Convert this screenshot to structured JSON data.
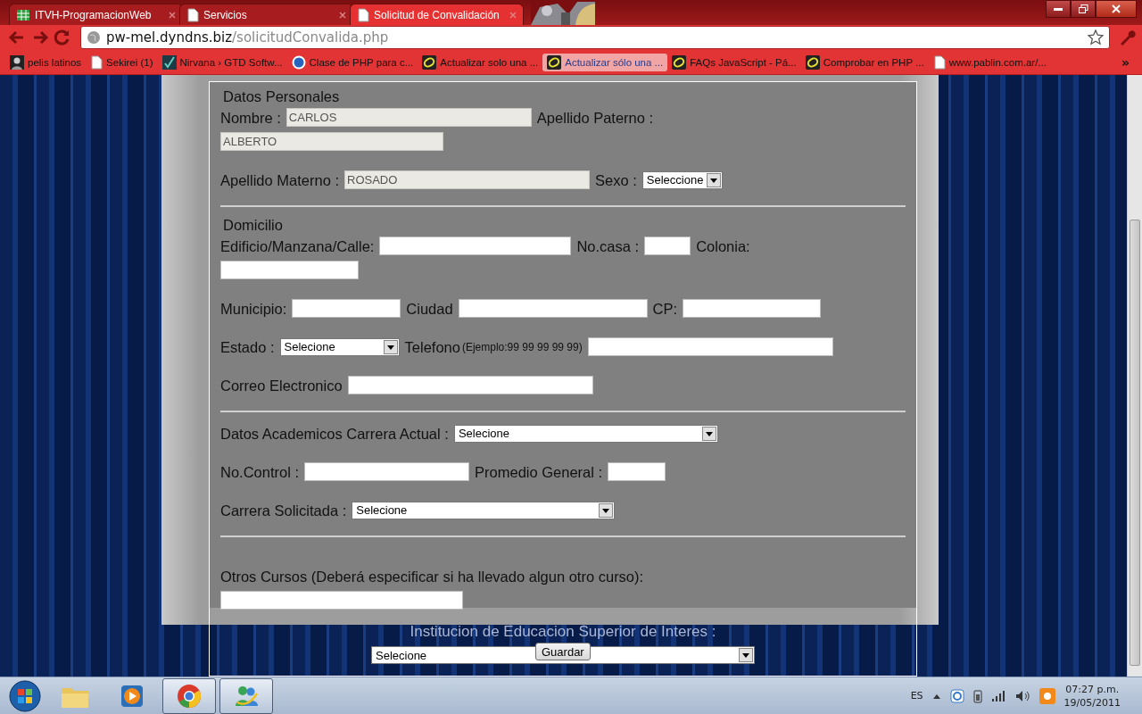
{
  "browser": {
    "tabs": [
      {
        "title": "ITVH-ProgramacionWeb",
        "selected": false
      },
      {
        "title": "Servicios",
        "selected": false
      },
      {
        "title": "Solicitud de Convalidación",
        "selected": true
      }
    ],
    "address": {
      "host": "pw-mel.dyndns.biz",
      "path": "/solicitudConvalida.php"
    },
    "bookmarks": [
      {
        "label": "pelis latinos",
        "selected": false
      },
      {
        "label": "Sekirei (1)",
        "selected": false
      },
      {
        "label": "Nirvana › GTD Softw...",
        "selected": false
      },
      {
        "label": "Clase de PHP para c...",
        "selected": false
      },
      {
        "label": "Actualizar solo una ...",
        "selected": false
      },
      {
        "label": "Actualizar sólo una ...",
        "selected": true
      },
      {
        "label": "FAQs JavaScript - Pá...",
        "selected": false
      },
      {
        "label": "Comprobar en PHP ...",
        "selected": false
      },
      {
        "label": "www.pablin.com.ar/...",
        "selected": false
      }
    ],
    "bookmarks_more": "»"
  },
  "form": {
    "sections": [
      {
        "title": "Datos Personales",
        "paragraphs": [
          [
            [
              {
                "kind": "label",
                "text": "Nombre :"
              },
              {
                "kind": "input",
                "value": "CARLOS",
                "disabled": true
              },
              {
                "kind": "label",
                "text": "Apellido Paterno :"
              }
            ],
            [
              {
                "kind": "input",
                "value": "ALBERTO",
                "disabled": true
              }
            ]
          ],
          [
            [
              {
                "kind": "label",
                "text": "Apellido Materno :"
              },
              {
                "kind": "input",
                "value": "ROSADO",
                "disabled": true
              },
              {
                "kind": "label",
                "text": "Sexo :"
              },
              {
                "kind": "select",
                "value": "Seleccione"
              }
            ]
          ]
        ]
      },
      {
        "title": "Domicilio",
        "paragraphs": [
          [
            [
              {
                "kind": "label",
                "text": "Edificio/Manzana/Calle:"
              },
              {
                "kind": "input",
                "disabled": false
              },
              {
                "kind": "label",
                "text": "No.casa :"
              },
              {
                "kind": "input",
                "disabled": false
              },
              {
                "kind": "label",
                "text": "Colonia:"
              }
            ],
            [
              {
                "kind": "input",
                "disabled": false
              }
            ]
          ],
          [
            [
              {
                "kind": "label",
                "text": "Municipio:"
              },
              {
                "kind": "input",
                "disabled": false
              },
              {
                "kind": "label",
                "text": "Ciudad"
              },
              {
                "kind": "input",
                "disabled": false
              },
              {
                "kind": "label",
                "text": "CP:"
              },
              {
                "kind": "input",
                "disabled": false
              }
            ]
          ],
          [
            [
              {
                "kind": "label",
                "text": "Estado :"
              },
              {
                "kind": "select",
                "value": "Selecione"
              },
              {
                "kind": "label",
                "text": "Telefono"
              },
              {
                "kind": "hint",
                "text": "(Ejemplo:99 99 99 99 99)"
              },
              {
                "kind": "input",
                "disabled": false
              }
            ]
          ],
          [
            [
              {
                "kind": "label",
                "text": "Correo Electronico"
              },
              {
                "kind": "input",
                "disabled": false
              }
            ]
          ]
        ]
      },
      {
        "paragraphs": [
          [
            [
              {
                "kind": "label",
                "text": "Datos Academicos Carrera Actual :"
              },
              {
                "kind": "select",
                "value": "Selecione"
              }
            ]
          ],
          [
            [
              {
                "kind": "label",
                "text": "No.Control :"
              },
              {
                "kind": "input",
                "disabled": false
              },
              {
                "kind": "label",
                "text": "Promedio General :"
              },
              {
                "kind": "input",
                "disabled": false
              }
            ]
          ],
          [
            [
              {
                "kind": "label",
                "text": "Carrera Solicitada :"
              },
              {
                "kind": "select",
                "value": "Selecione"
              }
            ]
          ]
        ]
      },
      {
        "paragraphs": [
          [
            [
              {
                "kind": "label",
                "text": "Otros Cursos (Deberá especificar si ha llevado algun otro curso):"
              }
            ],
            [
              {
                "kind": "input",
                "disabled": false
              }
            ]
          ]
        ]
      }
    ],
    "institution": {
      "label": "Institucion de Educacion Superior de Interes :",
      "select": "Selecione"
    },
    "submit": "Guardar"
  },
  "taskbar": {
    "apps": [
      {
        "running": false
      },
      {
        "running": false
      },
      {
        "running": true
      },
      {
        "running": true
      }
    ],
    "language": "ES",
    "time": "07:27 p.m.",
    "date": "19/05/2011"
  }
}
